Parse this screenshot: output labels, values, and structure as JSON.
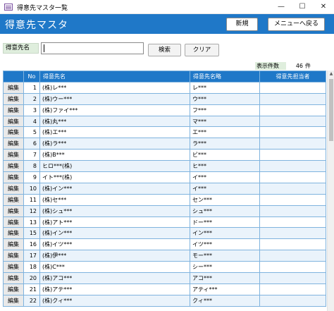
{
  "window": {
    "title": "得意先マスタ一覧",
    "min_glyph": "—",
    "max_glyph": "☐",
    "close_glyph": "✕"
  },
  "header": {
    "title": "得意先マスタ",
    "new_button": "新規",
    "back_button": "メニューへ戻る",
    "background": "#1f78c8"
  },
  "search": {
    "label": "得意先名",
    "value": "",
    "search_button": "検索",
    "clear_button": "クリア"
  },
  "count": {
    "label": "表示件数",
    "value": "46",
    "unit": "件"
  },
  "table": {
    "columns": [
      "",
      "No",
      "得意先名",
      "得意先名略",
      "得意先担当者"
    ],
    "edit_label": "編集",
    "rows": [
      {
        "no": "1",
        "name": "(株)レ***",
        "abbr": "レ***",
        "manager": ""
      },
      {
        "no": "2",
        "name": "(株)ウー***",
        "abbr": "ウ***",
        "manager": ""
      },
      {
        "no": "3",
        "name": "(株)ファイ***",
        "abbr": "フ***",
        "manager": ""
      },
      {
        "no": "4",
        "name": "(株)丸***",
        "abbr": "マ***",
        "manager": ""
      },
      {
        "no": "5",
        "name": "(株)エ***",
        "abbr": "エ***",
        "manager": ""
      },
      {
        "no": "6",
        "name": "(株)ラ***",
        "abbr": "ラ***",
        "manager": ""
      },
      {
        "no": "7",
        "name": "(株)B***",
        "abbr": "ビ***",
        "manager": ""
      },
      {
        "no": "8",
        "name": "ヒロ***(株)",
        "abbr": "ヒ***",
        "manager": ""
      },
      {
        "no": "9",
        "name": "イト***(株)",
        "abbr": "イ***",
        "manager": ""
      },
      {
        "no": "10",
        "name": "(株)イン***",
        "abbr": "イ***",
        "manager": ""
      },
      {
        "no": "11",
        "name": "(株)セ***",
        "abbr": "セン***",
        "manager": ""
      },
      {
        "no": "12",
        "name": "(株)シュ***",
        "abbr": "シュ***",
        "manager": ""
      },
      {
        "no": "13",
        "name": "(株)アト***",
        "abbr": "ドー***",
        "manager": ""
      },
      {
        "no": "15",
        "name": "(株)イン***",
        "abbr": "イン***",
        "manager": ""
      },
      {
        "no": "16",
        "name": "(株)イツ***",
        "abbr": "イツ***",
        "manager": ""
      },
      {
        "no": "17",
        "name": "(株)伊***",
        "abbr": "モー***",
        "manager": ""
      },
      {
        "no": "18",
        "name": "(株)C***",
        "abbr": "シー***",
        "manager": ""
      },
      {
        "no": "20",
        "name": "(株)アコ***",
        "abbr": "アコ***",
        "manager": ""
      },
      {
        "no": "21",
        "name": "(株)アテ***",
        "abbr": "アティ***",
        "manager": ""
      },
      {
        "no": "22",
        "name": "(株)クィ***",
        "abbr": "クィ***",
        "manager": ""
      }
    ]
  },
  "scrollbar": {
    "up_glyph": "▲"
  }
}
